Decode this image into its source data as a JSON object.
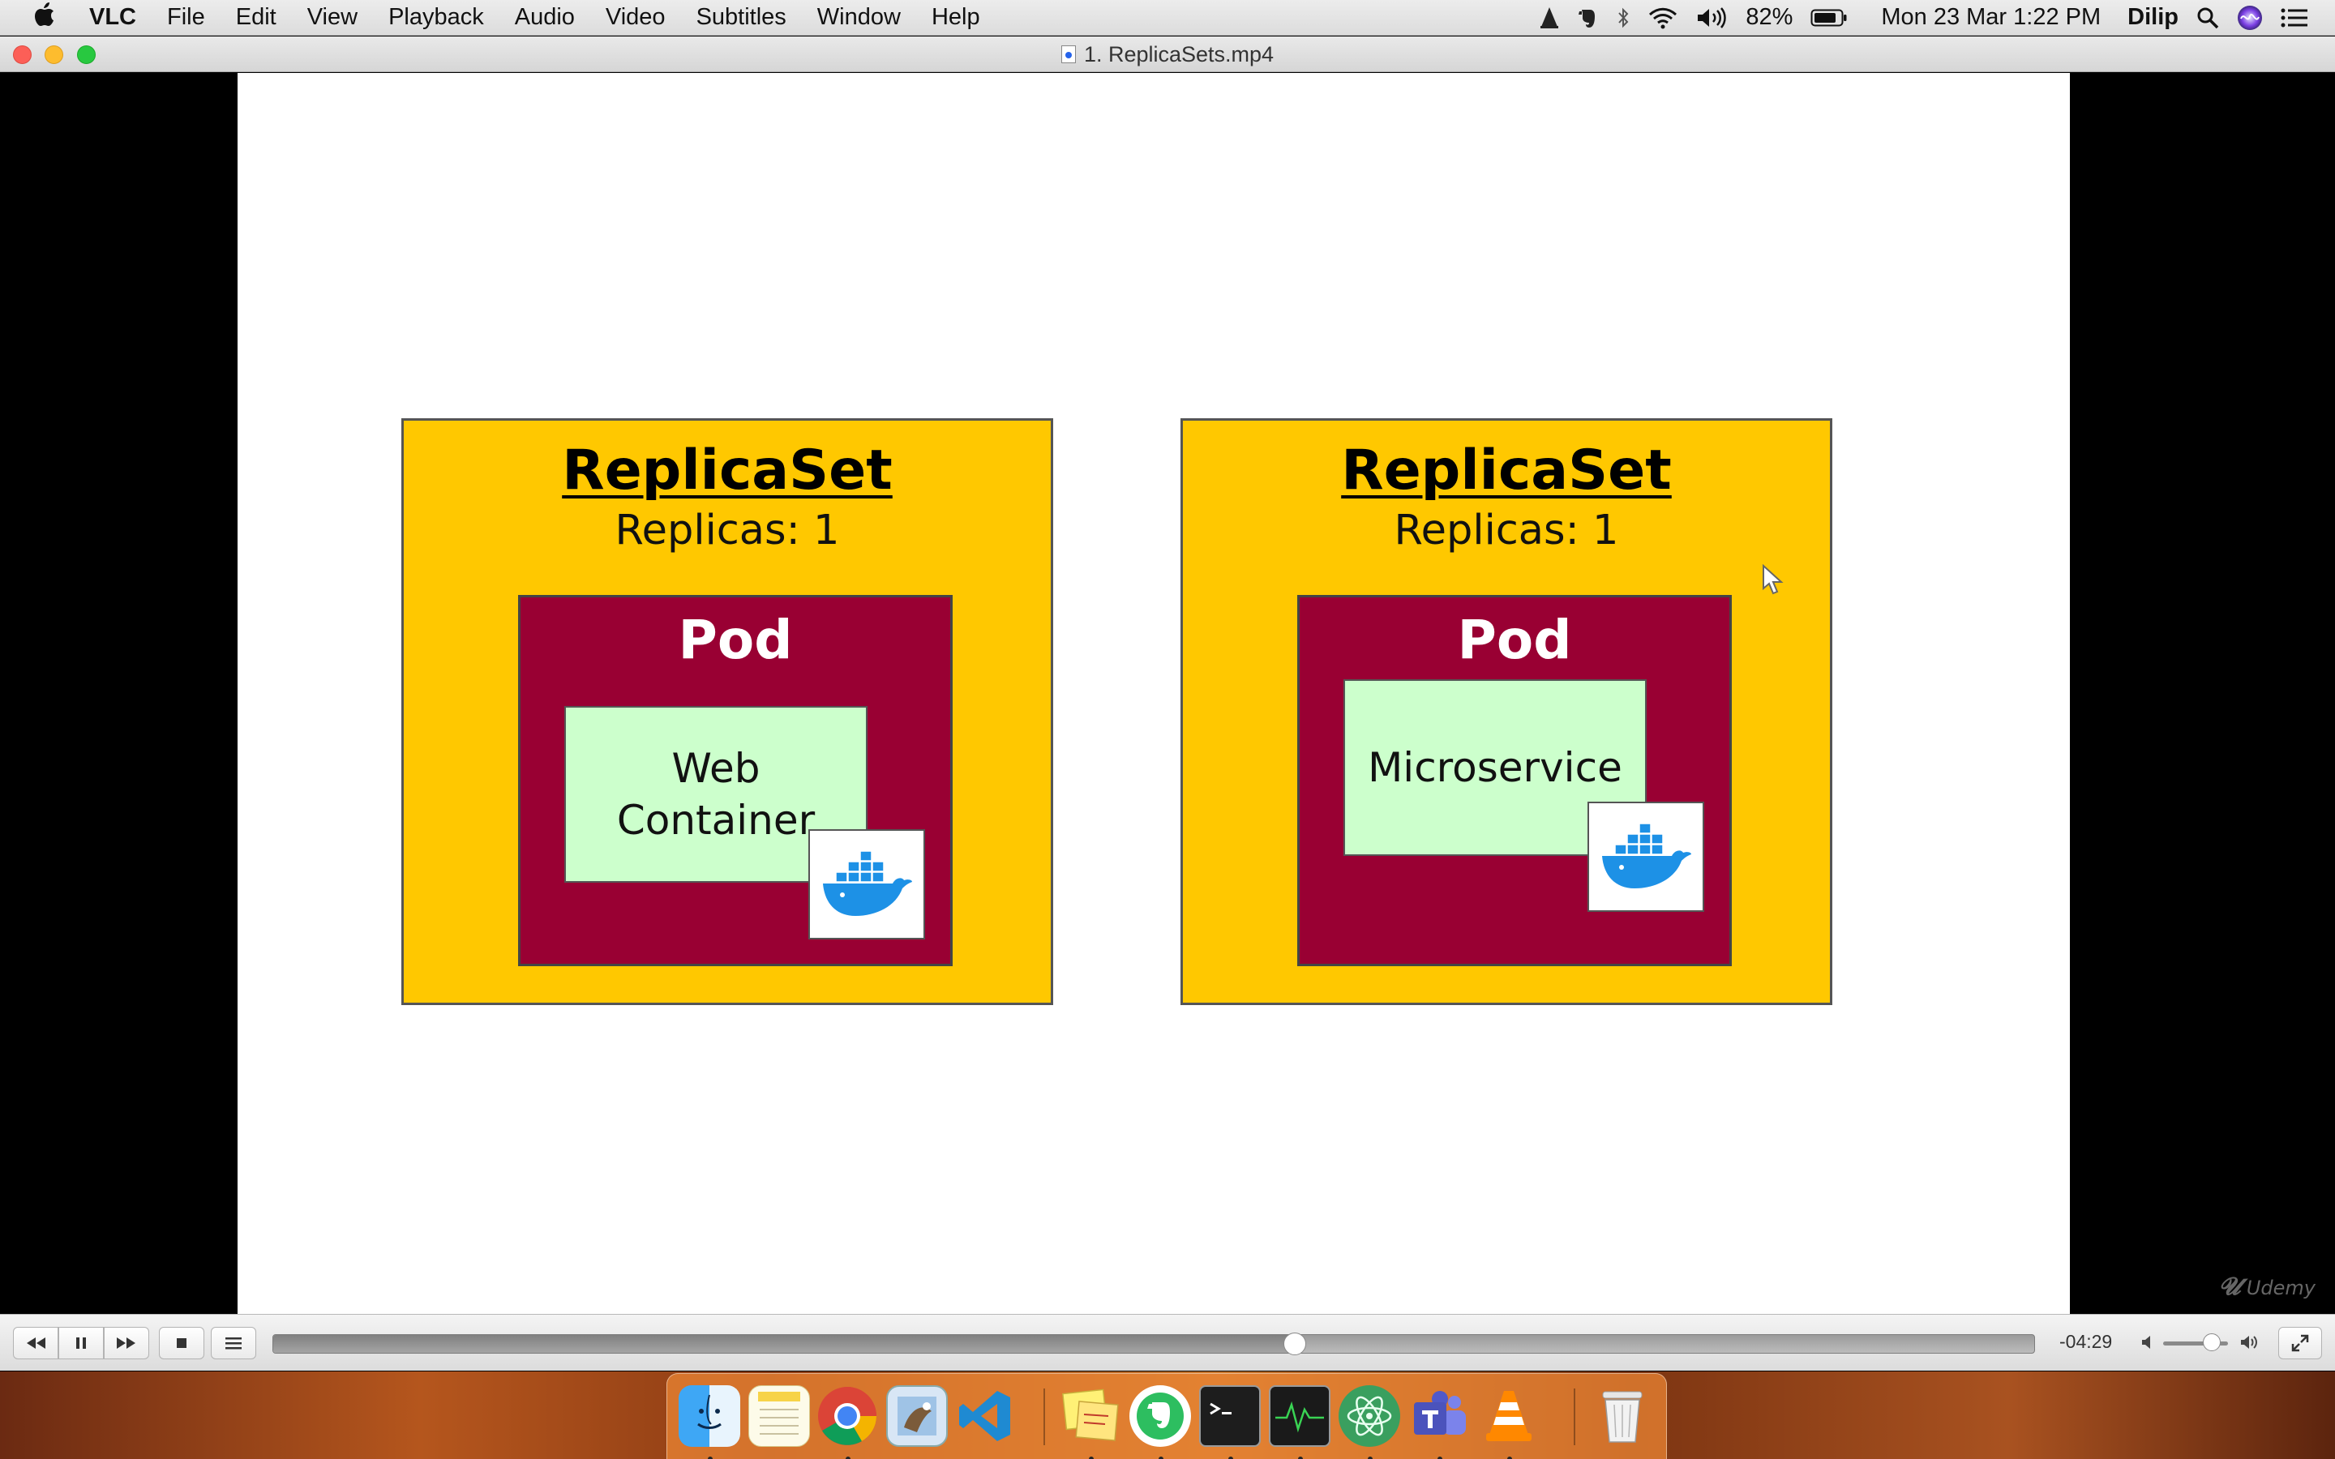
{
  "menubar": {
    "app_name": "VLC",
    "menus": [
      "File",
      "Edit",
      "View",
      "Playback",
      "Audio",
      "Video",
      "Subtitles",
      "Window",
      "Help"
    ],
    "battery_percent": "82%",
    "datetime": "Mon 23 Mar  1:22 PM",
    "user": "Dilip"
  },
  "window": {
    "title": "1. ReplicaSets.mp4"
  },
  "slide": {
    "left": {
      "title": "ReplicaSet",
      "replicas": "Replicas: 1",
      "pod_label": "Pod",
      "container_label": "Web\nContainer"
    },
    "right": {
      "title": "ReplicaSet",
      "replicas": "Replicas: 1",
      "pod_label": "Pod",
      "container_label": "Microservice"
    },
    "watermark": "Udemy"
  },
  "controls": {
    "time_remaining": "-04:29",
    "progress_fraction": 0.58,
    "volume_fraction": 0.75
  },
  "dock": {
    "apps": [
      "finder-icon",
      "notes-icon",
      "chrome-icon",
      "preview-icon",
      "vscode-icon",
      "stickies-icon",
      "evernote-icon",
      "terminal-icon",
      "activity-monitor-icon",
      "atom-icon",
      "teams-icon",
      "vlc-icon",
      "trash-icon"
    ]
  },
  "colors": {
    "replicaset_fill": "#ffc800",
    "pod_fill": "#990033",
    "container_fill": "#ccffcc"
  }
}
